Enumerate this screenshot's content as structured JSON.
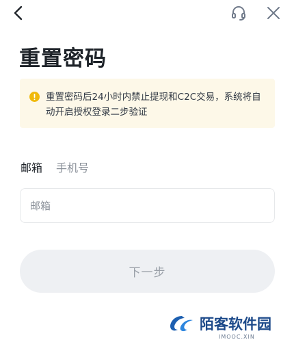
{
  "header": {
    "back_icon": "chevron-left-icon",
    "support_icon": "headset-icon",
    "close_icon": "close-icon"
  },
  "page": {
    "title": "重置密码"
  },
  "notice": {
    "icon": "warning-icon",
    "color": "#f0b90b",
    "background": "#fdf8e8",
    "text": "重置密码后24小时内禁止提现和C2C交易，系统将自动开启授权登录二步验证"
  },
  "tabs": [
    {
      "label": "邮箱",
      "selected": true
    },
    {
      "label": "手机号",
      "selected": false
    }
  ],
  "email_field": {
    "placeholder": "邮箱",
    "value": ""
  },
  "next_button": {
    "label": "下一步",
    "enabled": false
  },
  "watermark": {
    "name": "陌客软件园",
    "domain": "IMOOC.XIN"
  }
}
